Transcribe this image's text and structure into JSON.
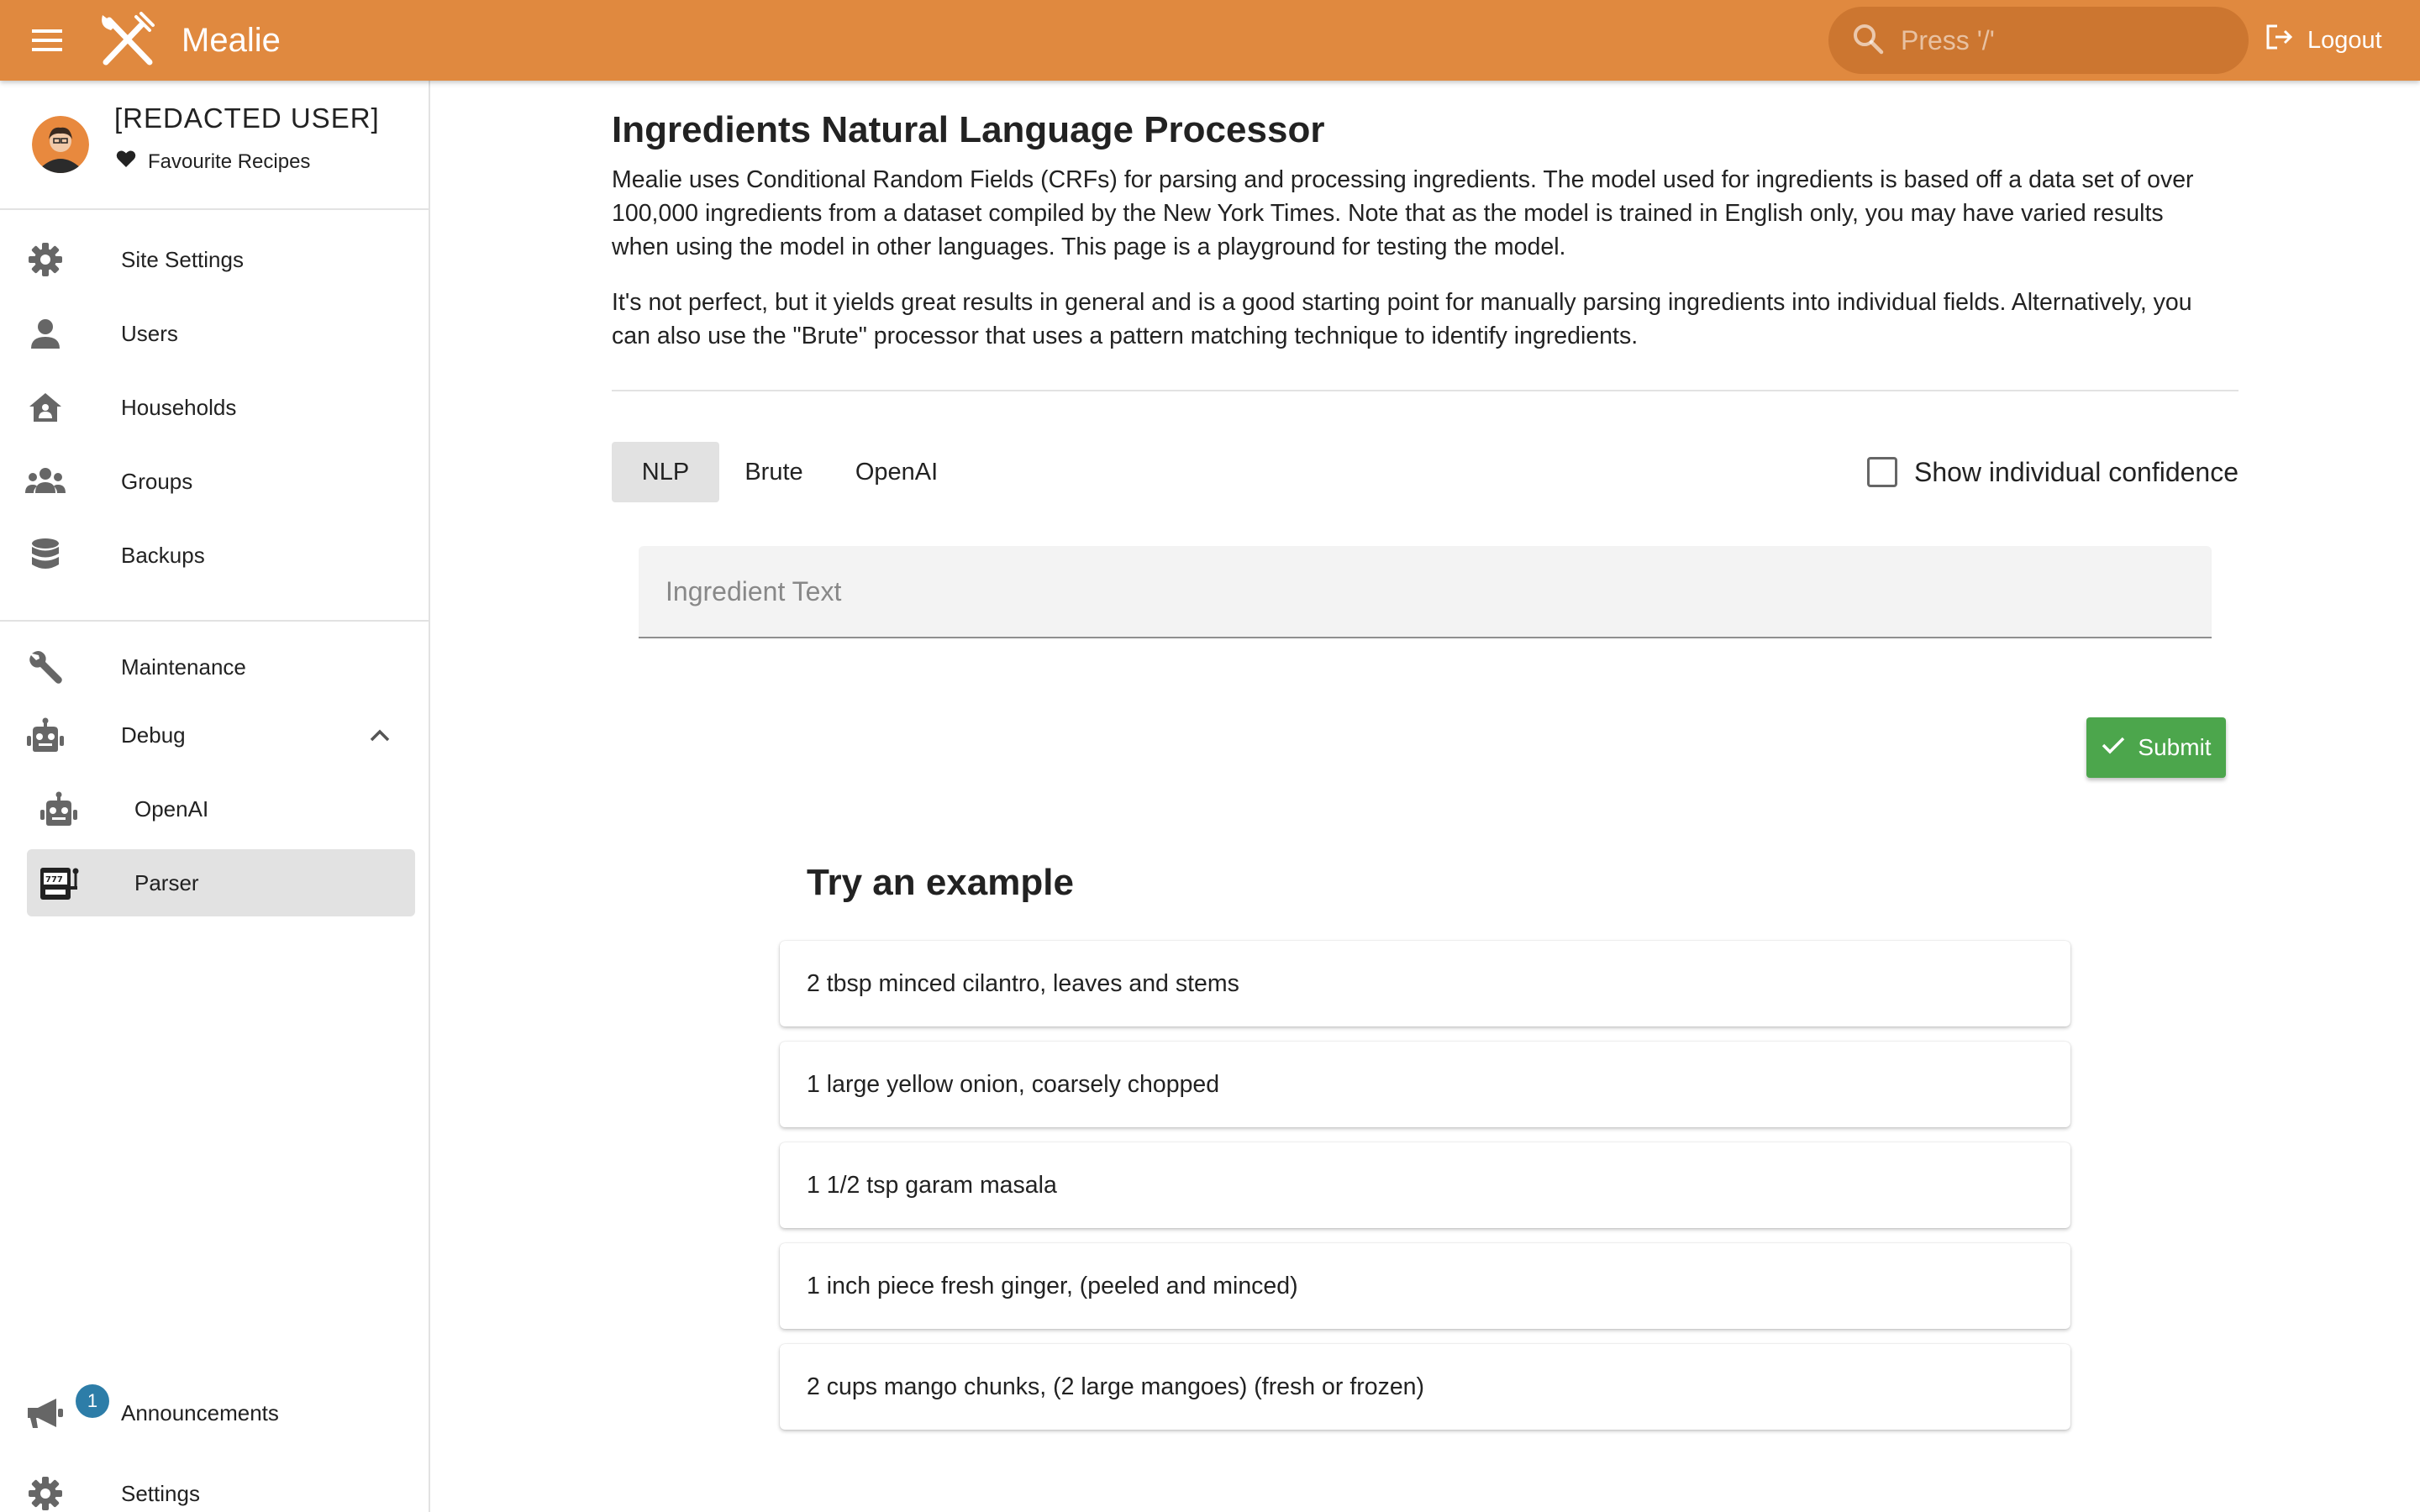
{
  "header": {
    "brand": "Mealie",
    "search_placeholder": "Press '/'",
    "logout_label": "Logout"
  },
  "user": {
    "name": "[REDACTED USER]",
    "favourites_label": "Favourite Recipes"
  },
  "sidebar": {
    "admin_items": [
      {
        "label": "Site Settings",
        "icon": "gear-icon"
      },
      {
        "label": "Users",
        "icon": "user-icon"
      },
      {
        "label": "Households",
        "icon": "home-icon"
      },
      {
        "label": "Groups",
        "icon": "group-icon"
      },
      {
        "label": "Backups",
        "icon": "database-icon"
      }
    ],
    "tools": {
      "maintenance": "Maintenance",
      "debug": "Debug",
      "openai": "OpenAI",
      "parser": "Parser"
    },
    "bottom": {
      "announcements": "Announcements",
      "announcements_badge": "1",
      "settings": "Settings"
    }
  },
  "main": {
    "title": "Ingredients Natural Language Processor",
    "paragraph1": "Mealie uses Conditional Random Fields (CRFs) for parsing and processing ingredients. The model used for ingredients is based off a data set of over 100,000 ingredients from a dataset compiled by the New York Times. Note that as the model is trained in English only, you may have varied results when using the model in other languages. This page is a playground for testing the model.",
    "paragraph2": "It's not perfect, but it yields great results in general and is a good starting point for manually parsing ingredients into individual fields. Alternatively, you can also use the \"Brute\" processor that uses a pattern matching technique to identify ingredients.",
    "tabs": [
      "NLP",
      "Brute",
      "OpenAI"
    ],
    "active_tab": "NLP",
    "confidence_label": "Show individual confidence",
    "confidence_checked": false,
    "ingredient_placeholder": "Ingredient Text",
    "ingredient_value": "",
    "submit_label": "Submit",
    "examples_title": "Try an example",
    "examples": [
      "2 tbsp minced cilantro, leaves and stems",
      "1 large yellow onion, coarsely chopped",
      "1 1/2 tsp garam masala",
      "1 inch piece fresh ginger, (peeled and minced)",
      "2 cups mango chunks, (2 large mangoes) (fresh or frozen)"
    ]
  },
  "colors": {
    "primary": "#E0893F",
    "success": "#4CA64C",
    "badge": "#2D7DA8",
    "active_bg": "#E2E2E2"
  }
}
